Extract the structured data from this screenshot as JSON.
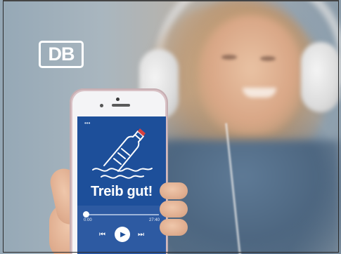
{
  "brand": {
    "logo_text": "DB",
    "logo_color": "#ffffff"
  },
  "phone": {
    "status_icon": "more-dots-icon",
    "status_text": "•••",
    "artwork_icon": "message-in-bottle-icon",
    "podcast_title": "Treib gut!",
    "player": {
      "elapsed": "0:00",
      "duration": "27:40",
      "progress": 0.02,
      "prev_icon": "skip-back-icon",
      "play_icon": "play-icon",
      "next_icon": "skip-forward-icon",
      "prev_glyph": "⏮",
      "play_glyph": "▶",
      "next_glyph": "⏭"
    },
    "screen_color": "#1d4f9a",
    "accent_red": "#d64040"
  }
}
